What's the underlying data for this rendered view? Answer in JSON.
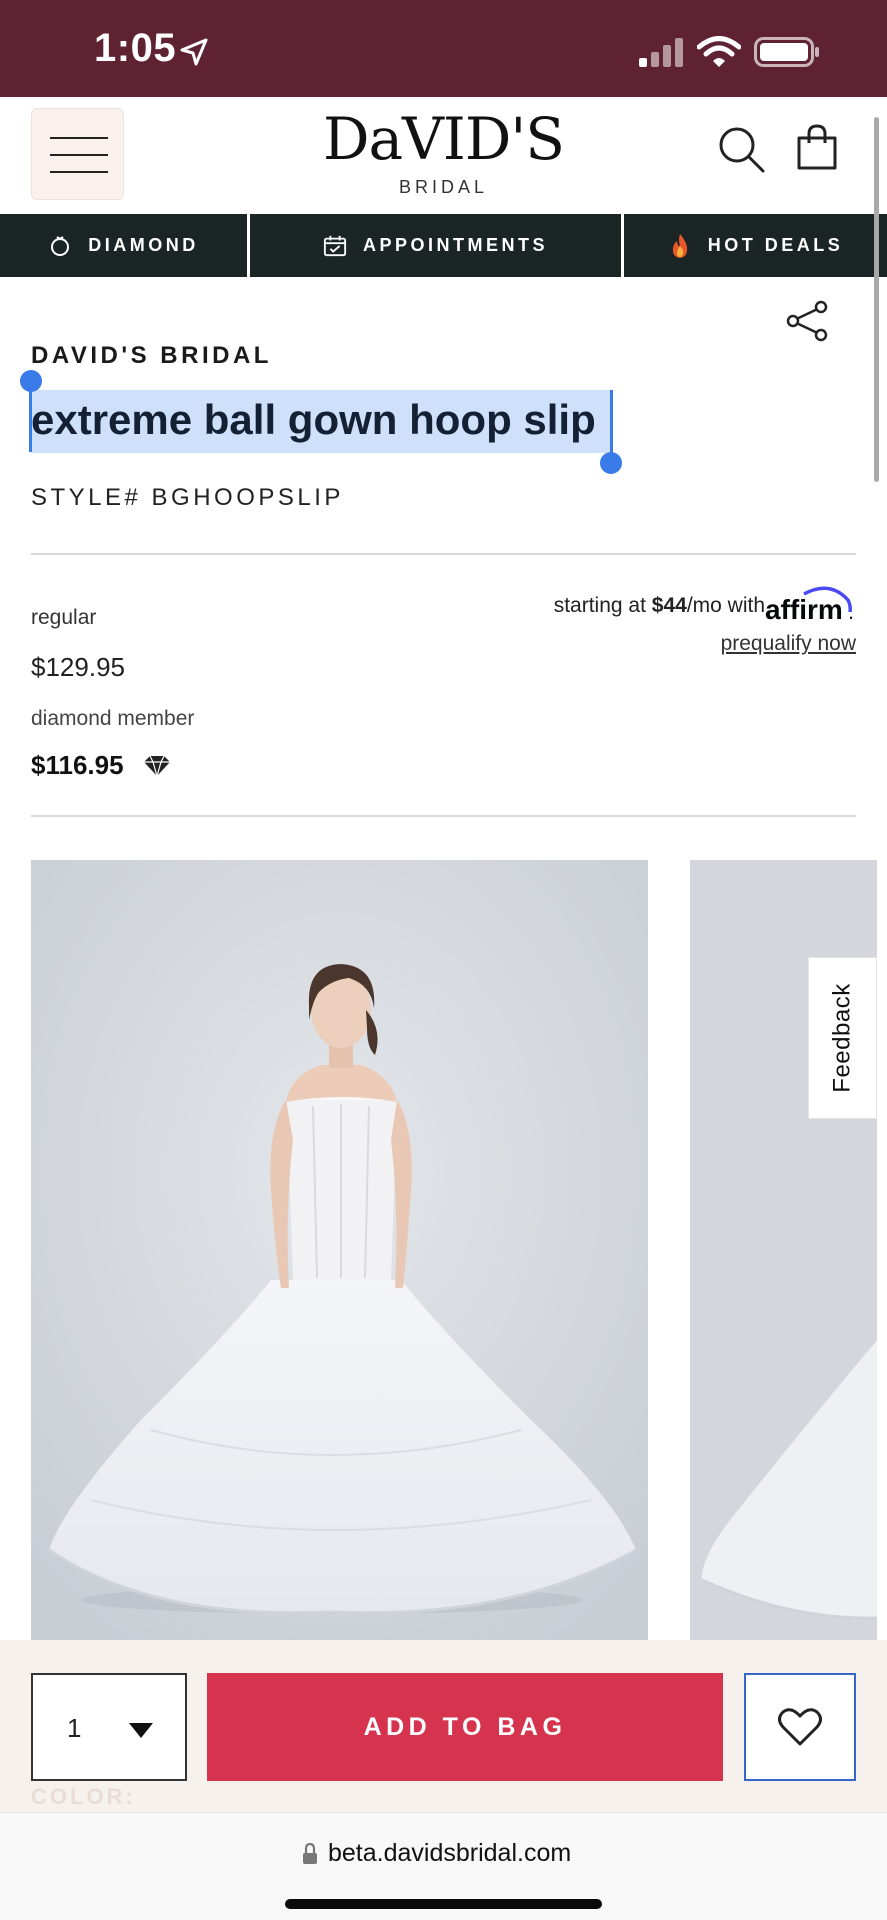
{
  "status_bar": {
    "time": "1:05",
    "background": "#5e2233"
  },
  "header": {
    "logo_main": "DaVID'S",
    "logo_sub": "BRIDAL",
    "icons": [
      "menu-icon",
      "search-icon",
      "shopping-bag-icon"
    ]
  },
  "nav": {
    "items": [
      {
        "label": "DIAMOND",
        "icon": "diamond-ring-icon"
      },
      {
        "label": "APPOINTMENTS",
        "icon": "calendar-icon"
      },
      {
        "label": "HOT DEALS",
        "icon": "fire-icon"
      }
    ],
    "background": "#1b2526"
  },
  "product": {
    "brand": "DAVID'S BRIDAL",
    "title": "extreme ball gown hoop slip",
    "style": "STYLE# BGHOOPSLIP",
    "regular_label": "regular",
    "regular_price": "$129.95",
    "diamond_label": "diamond member",
    "diamond_price": "$116.95",
    "financing": {
      "prefix": "starting at ",
      "amount": "$44",
      "suffix": "/mo with ",
      "provider": "affirm",
      "link": "prequalify now"
    }
  },
  "gallery": {
    "feedback_label": "Feedback"
  },
  "purchase": {
    "quantity": "1",
    "add_to_bag": "ADD TO BAG",
    "accent": "#d6334f",
    "color_label": "COLOR:"
  },
  "browser": {
    "url": "beta.davidsbridal.com"
  }
}
